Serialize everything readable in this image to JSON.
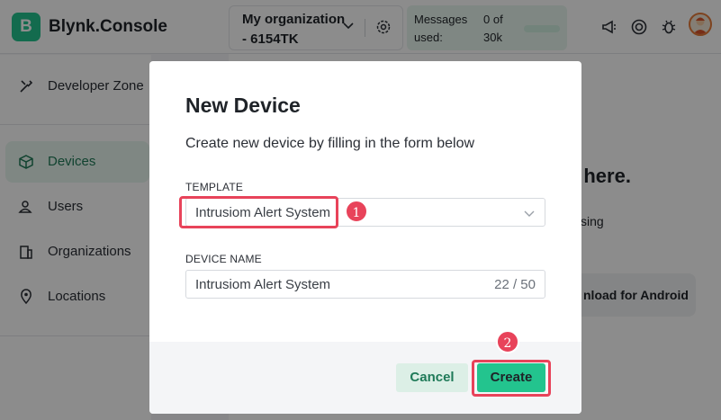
{
  "app": {
    "title": "Blynk.Console",
    "logo_letter": "B"
  },
  "header": {
    "org_name": "My organization - 6154TK",
    "messages_label": "Messages used:",
    "messages_count": "0 of 30k"
  },
  "sidebar": {
    "items": [
      {
        "label": "Developer Zone",
        "icon": "tools-icon"
      },
      {
        "label": "Devices",
        "icon": "cube-icon",
        "active": true
      },
      {
        "label": "Users",
        "icon": "users-icon"
      },
      {
        "label": "Organizations",
        "icon": "building-icon"
      },
      {
        "label": "Locations",
        "icon": "location-pin-icon"
      }
    ]
  },
  "background": {
    "title_fragment": "e here.",
    "sub_fragment": "sing",
    "button_fragment": "nload for Android"
  },
  "modal": {
    "title": "New Device",
    "description": "Create new device by filling in the form below",
    "template_label": "TEMPLATE",
    "template_value": "Intrusiom Alert System",
    "device_name_label": "DEVICE NAME",
    "device_name_value": "Intrusiom Alert System",
    "device_name_count": "22 / 50",
    "cancel_label": "Cancel",
    "create_label": "Create"
  },
  "annotations": {
    "marker_1": "1",
    "marker_2": "2"
  },
  "colors": {
    "accent": "#23c48e",
    "highlight": "#e8435a"
  }
}
